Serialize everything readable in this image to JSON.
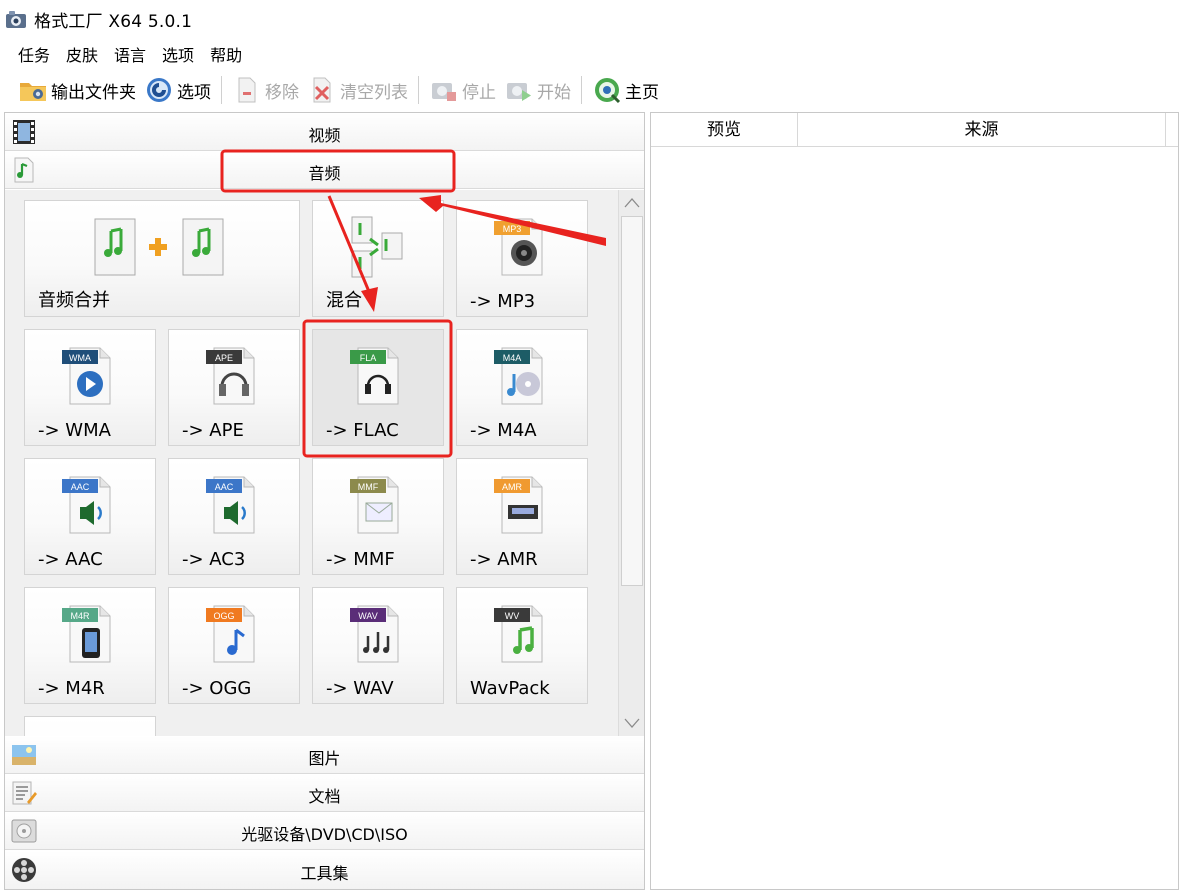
{
  "window": {
    "title": "格式工厂 X64 5.0.1"
  },
  "menu": [
    "任务",
    "皮肤",
    "语言",
    "选项",
    "帮助"
  ],
  "toolbar": {
    "output_folder": "输出文件夹",
    "options": "选项",
    "remove": "移除",
    "clear_list": "清空列表",
    "stop": "停止",
    "start": "开始",
    "home": "主页"
  },
  "categories": {
    "video": "视频",
    "audio": "音频",
    "picture": "图片",
    "document": "文档",
    "disc": "光驱设备\\DVD\\CD\\ISO",
    "tools": "工具集"
  },
  "audio_tiles": [
    {
      "label": "音频合并",
      "badge": "",
      "badge_color": ""
    },
    {
      "label": "混合",
      "badge": "",
      "badge_color": ""
    },
    {
      "label": "-> MP3",
      "badge": "MP3",
      "badge_color": "#f0a030"
    },
    {
      "label": "-> WMA",
      "badge": "WMA",
      "badge_color": "#1f4e79"
    },
    {
      "label": "-> APE",
      "badge": "APE",
      "badge_color": "#3a3a3a"
    },
    {
      "label": "-> FLAC",
      "badge": "FLA",
      "badge_color": "#3a9a48"
    },
    {
      "label": "-> M4A",
      "badge": "M4A",
      "badge_color": "#1d5c66"
    },
    {
      "label": "-> AAC",
      "badge": "AAC",
      "badge_color": "#3c76c8"
    },
    {
      "label": "-> AC3",
      "badge": "AAC",
      "badge_color": "#3c76c8"
    },
    {
      "label": "-> MMF",
      "badge": "MMF",
      "badge_color": "#8c8a4c"
    },
    {
      "label": "-> AMR",
      "badge": "AMR",
      "badge_color": "#f09a30"
    },
    {
      "label": "-> M4R",
      "badge": "M4R",
      "badge_color": "#56a888"
    },
    {
      "label": "-> OGG",
      "badge": "OGG",
      "badge_color": "#f07a20"
    },
    {
      "label": "-> WAV",
      "badge": "WAV",
      "badge_color": "#5a2d78"
    },
    {
      "label": "WavPack",
      "badge": "WV",
      "badge_color": "#3a3a3a"
    }
  ],
  "task_table": {
    "columns": [
      "预览",
      "来源"
    ]
  },
  "annotation_color": "#e8231f"
}
